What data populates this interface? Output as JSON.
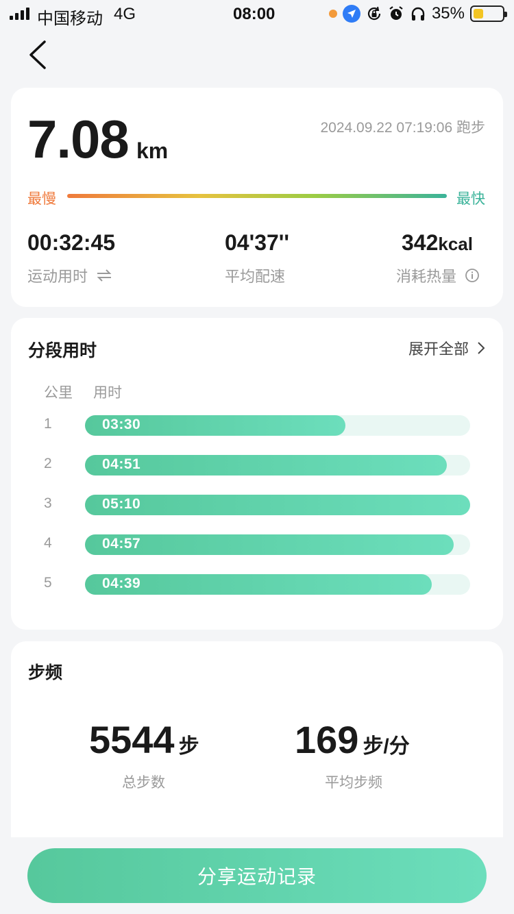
{
  "status_bar": {
    "carrier": "中国移动",
    "network": "4G",
    "time": "08:00",
    "battery": "35%",
    "battery_level": 0.35
  },
  "summary": {
    "distance": "7.08",
    "distance_unit": "km",
    "datetime": "2024.09.22 07:19:06 跑步",
    "slow_label": "最慢",
    "fast_label": "最快",
    "duration": "00:32:45",
    "duration_label": "运动用时",
    "avg_pace": "04'37''",
    "avg_pace_label": "平均配速",
    "calories": "342",
    "calories_unit": "kcal",
    "calories_label": "消耗热量"
  },
  "splits": {
    "title": "分段用时",
    "expand_label": "展开全部",
    "col_km": "公里",
    "col_time": "用时",
    "rows": [
      {
        "km": "1",
        "time": "03:30",
        "ratio": 0.677
      },
      {
        "km": "2",
        "time": "04:51",
        "ratio": 0.939
      },
      {
        "km": "3",
        "time": "05:10",
        "ratio": 1.0
      },
      {
        "km": "4",
        "time": "04:57",
        "ratio": 0.958
      },
      {
        "km": "5",
        "time": "04:39",
        "ratio": 0.9
      }
    ]
  },
  "cadence": {
    "title": "步频",
    "total_steps": "5544",
    "total_steps_unit": "步",
    "total_steps_label": "总步数",
    "avg_cadence": "169",
    "avg_cadence_unit": "步/分",
    "avg_cadence_label": "平均步频"
  },
  "share_button": "分享运动记录",
  "colors": {
    "accent": "#5fd3ac",
    "slow": "#ef7a3c",
    "fast": "#3bb39a"
  }
}
